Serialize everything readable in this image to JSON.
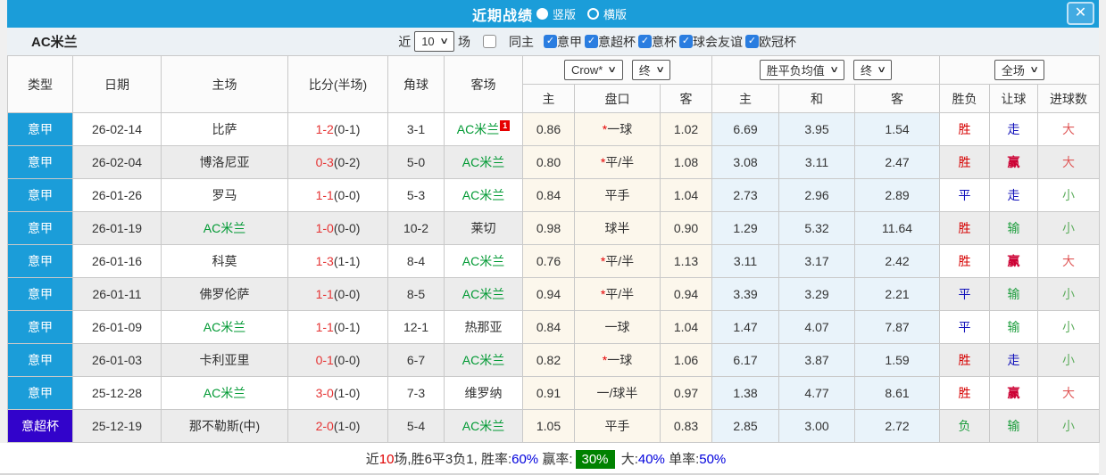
{
  "icons": {
    "chevron_down": "∨",
    "check": "✓",
    "close": "✕"
  },
  "colors": {
    "accent_blue": "#1b9dd9",
    "league_badge_blue": "#1b9dd9",
    "league_badge_purple": "#3203cb",
    "team_green": "#009933",
    "score_red": "#e53333",
    "win_red": "#d60000",
    "draw_blue": "#1414bb",
    "lose_green": "#1e9e3e",
    "checkbox_blue": "#2a7de0",
    "footer_green_box": "#008200"
  },
  "titlebar": {
    "title": "近期战绩",
    "option_vertical": "竖版",
    "option_horizontal": "横版",
    "selected_option": "竖版"
  },
  "filterbar": {
    "team": "AC米兰",
    "recent_label": "近",
    "recent_value": "10",
    "unit_label": "场",
    "same_home": {
      "label": "同主",
      "checked": false
    },
    "competitions": [
      {
        "label": "意甲",
        "checked": true
      },
      {
        "label": "意超杯",
        "checked": true
      },
      {
        "label": "意杯",
        "checked": true
      },
      {
        "label": "球会友谊",
        "checked": true
      },
      {
        "label": "欧冠杯",
        "checked": true
      }
    ]
  },
  "table": {
    "header": {
      "col_type": "类型",
      "col_date": "日期",
      "col_home": "主场",
      "col_score": "比分(半场)",
      "col_corner": "角球",
      "col_away": "客场",
      "select_odds_source": "Crow*",
      "select_odds_time": "终",
      "select_avg": "胜平负均值",
      "select_avg_time": "终",
      "select_scope": "全场",
      "sub_home": "主",
      "sub_handicap": "盘口",
      "sub_away": "客",
      "sub_avg_home": "主",
      "sub_avg_draw": "和",
      "sub_avg_away": "客",
      "col_wdl": "胜负",
      "col_handicap_result": "让球",
      "col_goals": "进球数"
    },
    "rows": [
      {
        "league": "意甲",
        "league_color": "blue",
        "date": "26-02-14",
        "home": "比萨",
        "home_is_team": false,
        "score_ft": "1-2",
        "score_ht": "(0-1)",
        "corner": "3-1",
        "away": "AC米兰",
        "away_is_team": true,
        "away_sup": "1",
        "crow_home": "0.86",
        "crow_star": true,
        "crow_handicap": "一球",
        "crow_away": "1.02",
        "avg_home": "6.69",
        "avg_draw": "3.95",
        "avg_away": "1.54",
        "res_wdl": "胜",
        "res_wdl_c": "red",
        "res_handi": "走",
        "res_handi_c": "blue",
        "res_goal": "大",
        "res_goal_c": "big"
      },
      {
        "league": "意甲",
        "league_color": "blue",
        "date": "26-02-04",
        "home": "博洛尼亚",
        "home_is_team": false,
        "score_ft": "0-3",
        "score_ht": "(0-2)",
        "corner": "5-0",
        "away": "AC米兰",
        "away_is_team": true,
        "crow_home": "0.80",
        "crow_star": true,
        "crow_handicap": "平/半",
        "crow_away": "1.08",
        "avg_home": "3.08",
        "avg_draw": "3.11",
        "avg_away": "2.47",
        "res_wdl": "胜",
        "res_wdl_c": "red",
        "res_handi": "赢",
        "res_handi_c": "win",
        "res_goal": "大",
        "res_goal_c": "big"
      },
      {
        "league": "意甲",
        "league_color": "blue",
        "date": "26-01-26",
        "home": "罗马",
        "home_is_team": false,
        "score_ft": "1-1",
        "score_ht": "(0-0)",
        "corner": "5-3",
        "away": "AC米兰",
        "away_is_team": true,
        "crow_home": "0.84",
        "crow_star": false,
        "crow_handicap": "平手",
        "crow_away": "1.04",
        "avg_home": "2.73",
        "avg_draw": "2.96",
        "avg_away": "2.89",
        "res_wdl": "平",
        "res_wdl_c": "blue",
        "res_handi": "走",
        "res_handi_c": "blue",
        "res_goal": "小",
        "res_goal_c": "small"
      },
      {
        "league": "意甲",
        "league_color": "blue",
        "date": "26-01-19",
        "home": "AC米兰",
        "home_is_team": true,
        "score_ft": "1-0",
        "score_ht": "(0-0)",
        "corner": "10-2",
        "away": "莱切",
        "away_is_team": false,
        "crow_home": "0.98",
        "crow_star": false,
        "crow_handicap": "球半",
        "crow_away": "0.90",
        "avg_home": "1.29",
        "avg_draw": "5.32",
        "avg_away": "11.64",
        "res_wdl": "胜",
        "res_wdl_c": "red",
        "res_handi": "输",
        "res_handi_c": "green",
        "res_goal": "小",
        "res_goal_c": "small"
      },
      {
        "league": "意甲",
        "league_color": "blue",
        "date": "26-01-16",
        "home": "科莫",
        "home_is_team": false,
        "score_ft": "1-3",
        "score_ht": "(1-1)",
        "corner": "8-4",
        "away": "AC米兰",
        "away_is_team": true,
        "crow_home": "0.76",
        "crow_star": true,
        "crow_handicap": "平/半",
        "crow_away": "1.13",
        "avg_home": "3.11",
        "avg_draw": "3.17",
        "avg_away": "2.42",
        "res_wdl": "胜",
        "res_wdl_c": "red",
        "res_handi": "赢",
        "res_handi_c": "win",
        "res_goal": "大",
        "res_goal_c": "big"
      },
      {
        "league": "意甲",
        "league_color": "blue",
        "date": "26-01-11",
        "home": "佛罗伦萨",
        "home_is_team": false,
        "score_ft": "1-1",
        "score_ht": "(0-0)",
        "corner": "8-5",
        "away": "AC米兰",
        "away_is_team": true,
        "crow_home": "0.94",
        "crow_star": true,
        "crow_handicap": "平/半",
        "crow_away": "0.94",
        "avg_home": "3.39",
        "avg_draw": "3.29",
        "avg_away": "2.21",
        "res_wdl": "平",
        "res_wdl_c": "blue",
        "res_handi": "输",
        "res_handi_c": "green",
        "res_goal": "小",
        "res_goal_c": "small"
      },
      {
        "league": "意甲",
        "league_color": "blue",
        "date": "26-01-09",
        "home": "AC米兰",
        "home_is_team": true,
        "score_ft": "1-1",
        "score_ht": "(0-1)",
        "corner": "12-1",
        "away": "热那亚",
        "away_is_team": false,
        "crow_home": "0.84",
        "crow_star": false,
        "crow_handicap": "一球",
        "crow_away": "1.04",
        "avg_home": "1.47",
        "avg_draw": "4.07",
        "avg_away": "7.87",
        "res_wdl": "平",
        "res_wdl_c": "blue",
        "res_handi": "输",
        "res_handi_c": "green",
        "res_goal": "小",
        "res_goal_c": "small"
      },
      {
        "league": "意甲",
        "league_color": "blue",
        "date": "26-01-03",
        "home": "卡利亚里",
        "home_is_team": false,
        "score_ft": "0-1",
        "score_ht": "(0-0)",
        "corner": "6-7",
        "away": "AC米兰",
        "away_is_team": true,
        "crow_home": "0.82",
        "crow_star": true,
        "crow_handicap": "一球",
        "crow_away": "1.06",
        "avg_home": "6.17",
        "avg_draw": "3.87",
        "avg_away": "1.59",
        "res_wdl": "胜",
        "res_wdl_c": "red",
        "res_handi": "走",
        "res_handi_c": "blue",
        "res_goal": "小",
        "res_goal_c": "small"
      },
      {
        "league": "意甲",
        "league_color": "blue",
        "date": "25-12-28",
        "home": "AC米兰",
        "home_is_team": true,
        "score_ft": "3-0",
        "score_ht": "(1-0)",
        "corner": "7-3",
        "away": "维罗纳",
        "away_is_team": false,
        "crow_home": "0.91",
        "crow_star": false,
        "crow_handicap": "一/球半",
        "crow_away": "0.97",
        "avg_home": "1.38",
        "avg_draw": "4.77",
        "avg_away": "8.61",
        "res_wdl": "胜",
        "res_wdl_c": "red",
        "res_handi": "赢",
        "res_handi_c": "win",
        "res_goal": "大",
        "res_goal_c": "big"
      },
      {
        "league": "意超杯",
        "league_color": "purple",
        "date": "25-12-19",
        "home": "那不勒斯(中)",
        "home_is_team": false,
        "score_ft": "2-0",
        "score_ht": "(1-0)",
        "corner": "5-4",
        "away": "AC米兰",
        "away_is_team": true,
        "crow_home": "1.05",
        "crow_star": false,
        "crow_handicap": "平手",
        "crow_away": "0.83",
        "avg_home": "2.85",
        "avg_draw": "3.00",
        "avg_away": "2.72",
        "res_wdl": "负",
        "res_wdl_c": "green",
        "res_handi": "输",
        "res_handi_c": "green",
        "res_goal": "小",
        "res_goal_c": "small"
      }
    ]
  },
  "footer": {
    "pieces": [
      {
        "t": "近",
        "s": "plain"
      },
      {
        "t": "10",
        "s": "red"
      },
      {
        "t": "场,胜6平3负1, 胜率:",
        "s": "plain"
      },
      {
        "t": "60%",
        "s": "blue"
      },
      {
        "t": " 赢率:",
        "s": "plain"
      },
      {
        "t": "30%",
        "s": "greenbox"
      },
      {
        "t": " 大:",
        "s": "plain"
      },
      {
        "t": "40%",
        "s": "blue"
      },
      {
        "t": " 单率:",
        "s": "plain"
      },
      {
        "t": "50%",
        "s": "blue"
      }
    ]
  }
}
